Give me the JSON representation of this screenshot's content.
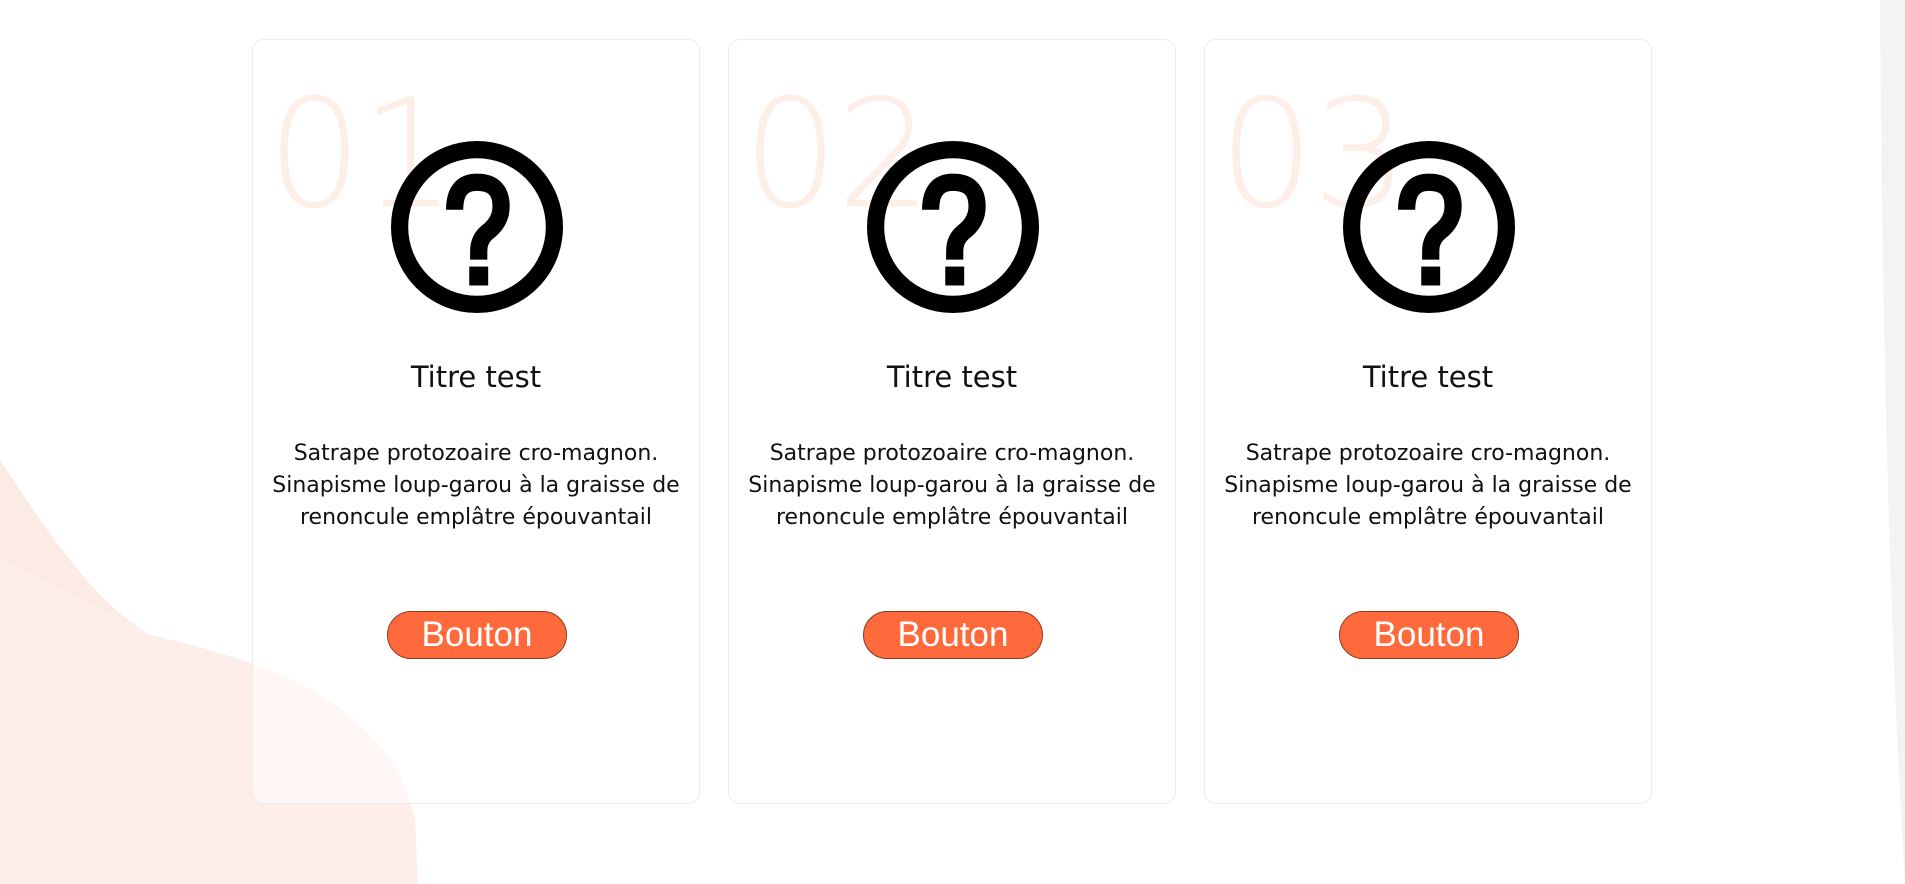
{
  "colors": {
    "accent": "#ff6a3d",
    "number_tint": "#fdeee7",
    "background_blob": "#fdeee9",
    "card_border": "#ececec"
  },
  "cards": [
    {
      "number": "01",
      "icon": "help-circle-icon",
      "title": "Titre test",
      "text_lines": [
        "Satrape protozoaire cro-magnon.",
        "Sinapisme loup-garou à la graisse de",
        "renoncule emplâtre épouvantail"
      ],
      "button_label": "Bouton"
    },
    {
      "number": "02",
      "icon": "help-circle-icon",
      "title": "Titre test",
      "text_lines": [
        "Satrape protozoaire cro-magnon.",
        "Sinapisme loup-garou à la graisse de",
        "renoncule emplâtre épouvantail"
      ],
      "button_label": "Bouton"
    },
    {
      "number": "03",
      "icon": "help-circle-icon",
      "title": "Titre test",
      "text_lines": [
        "Satrape protozoaire cro-magnon.",
        "Sinapisme loup-garou à la graisse de",
        "renoncule emplâtre épouvantail"
      ],
      "button_label": "Bouton"
    }
  ]
}
